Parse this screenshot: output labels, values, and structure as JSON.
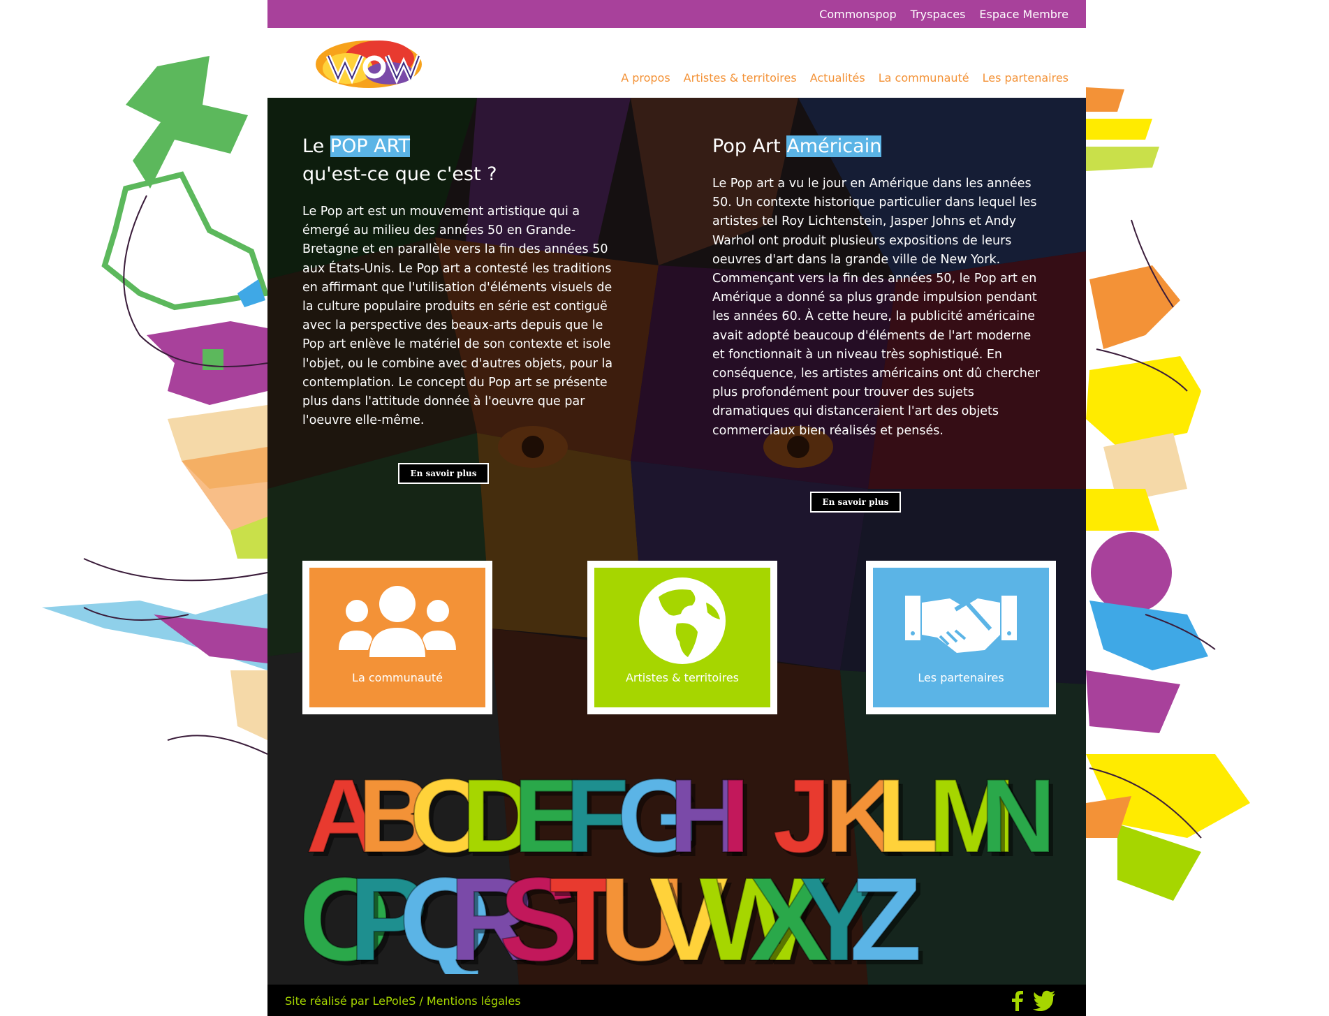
{
  "topbar": {
    "links": [
      "Commonspop",
      "Tryspaces",
      "Espace Membre"
    ],
    "color": "#a8419b"
  },
  "header": {
    "logo_alt": "WOW logo",
    "nav": [
      "A propos",
      "Artistes & territoires",
      "Actualités",
      "La communauté",
      "Les partenaires"
    ],
    "nav_color": "#f39237"
  },
  "left_article": {
    "title_prefix": "Le",
    "title_highlight": "POP ART",
    "title_line2": "qu'est-ce que c'est ?",
    "body": "Le Pop art est un mouvement artistique qui a émergé au milieu des années 50 en Grande-Bretagne et en parallèle vers la fin des années 50 aux États-Unis. Le Pop art a contesté les traditions en affirmant que l'utilisation d'éléments visuels de la culture populaire produits en série est contiguë avec la perspective des beaux-arts depuis que le Pop art enlève le matériel de son contexte et isole l'objet, ou le combine avec d'autres objets, pour la contemplation. Le concept du Pop art se présente plus dans l'attitude donnée à l'oeuvre que par l'oeuvre elle-même.",
    "button": "En savoir plus"
  },
  "right_article": {
    "title_prefix": "Pop Art",
    "title_highlight": "Américain",
    "body": "Le Pop art a vu le jour en Amérique dans les années 50. Un contexte historique particulier dans lequel les artistes tel Roy Lichtenstein, Jasper Johns et Andy Warhol ont produit plusieurs expositions de leurs oeuvres d'art dans la grande ville de New York. Commençant vers la fin des années 50, le Pop art en Amérique a donné sa plus grande impulsion pendant les années 60. À cette heure, la publicité américaine avait adopté beaucoup d'éléments de l'art moderne et fonctionnait à un niveau très sophistiqué. En conséquence, les artistes américains ont dû chercher plus profondément pour trouver des sujets dramatiques qui distanceraient l'art des objets commerciaux bien réalisés et pensés.",
    "button": "En savoir plus"
  },
  "tiles": [
    {
      "label": "La communauté",
      "icon": "group-icon",
      "color": "#f39237"
    },
    {
      "label": "Artistes & territoires",
      "icon": "globe-icon",
      "color": "#a6d600"
    },
    {
      "label": "Les partenaires",
      "icon": "handshake-icon",
      "color": "#5bb4e6"
    }
  ],
  "alphabet_image": {
    "row1": "ABCDEFGHIJKLMN",
    "row2": "OPQRSTUVWXYZ"
  },
  "footer": {
    "credits": "Site réalisé par LePoleS / Mentions légales",
    "social": [
      "facebook-icon",
      "twitter-icon"
    ],
    "text_color": "#a6d600"
  }
}
